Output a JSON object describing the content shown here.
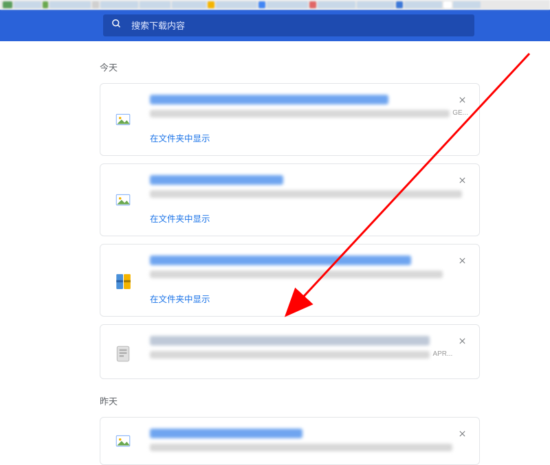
{
  "search": {
    "placeholder": "搜索下载内容"
  },
  "sections": [
    {
      "label": "今天"
    },
    {
      "label": "昨天"
    }
  ],
  "items": [
    {
      "icon": "image",
      "show_in_folder": "在文件夹中显示",
      "url_trail": "GE...",
      "blurred": true
    },
    {
      "icon": "image",
      "show_in_folder": "在文件夹中显示",
      "url_trail": "",
      "blurred": true
    },
    {
      "icon": "archive",
      "show_in_folder": "在文件夹中显示",
      "url_trail": "",
      "blurred": true
    },
    {
      "icon": "exe",
      "show_in_folder": "",
      "url_trail": "APR...",
      "blurred": true
    }
  ],
  "items_yesterday": [
    {
      "icon": "image",
      "show_in_folder": "",
      "url_trail": "",
      "blurred": true
    }
  ],
  "colors": {
    "accent": "#1a73e8",
    "header": "#2a62d9",
    "arrow": "#ff0000"
  }
}
